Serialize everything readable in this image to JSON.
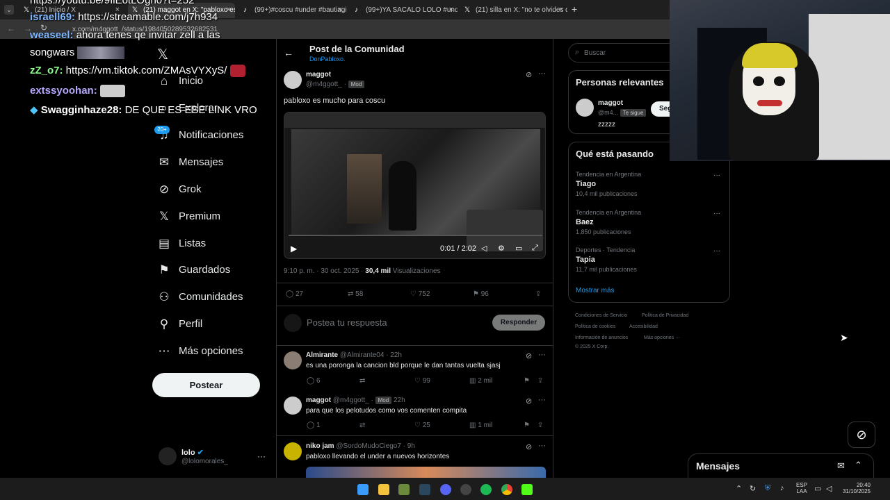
{
  "tabs": [
    {
      "label": "(21) Inicio / X"
    },
    {
      "label": "(21) maggot en X: \"pabloxo es mu"
    },
    {
      "label": "(99+)#coscu #under #bautiagi"
    },
    {
      "label": "(99+)YA SACALO LOLO #under"
    },
    {
      "label": "(21) silla en X: \"no te olvides de"
    }
  ],
  "address": {
    "url": "x.com/m4ggott_/status/1984050289532682531"
  },
  "chat": [
    {
      "user": "",
      "text": "https://youtu.be/9IiEotLOgh0?t=252"
    },
    {
      "user": "israell69:",
      "text": " https://streamable.com/j7h934",
      "color": "#7fb7ff"
    },
    {
      "user": "weaseel:",
      "text": " ahora tenes qe invitar zell a las",
      "color": "#7fb7ff"
    },
    {
      "user": "",
      "text": "songwars"
    },
    {
      "user": "zZ_o7:",
      "text": " https://vm.tiktok.com/ZMAsVYXyS/",
      "color": "#8fff8f"
    },
    {
      "user": "extssyoohan:",
      "text": "",
      "color": "#b8a8ff"
    },
    {
      "user": "Swagginhaze28:",
      "text": " DE QUE ES ESE LINK VRO",
      "color": "#ffffff"
    }
  ],
  "sidebar": {
    "items": [
      {
        "label": "Inicio",
        "icon": "home-icon",
        "glyph": "⌂"
      },
      {
        "label": "Explorar",
        "icon": "search-icon",
        "glyph": "⌕"
      },
      {
        "label": "Notificaciones",
        "icon": "bell-icon",
        "glyph": "♫",
        "badge": "20+"
      },
      {
        "label": "Mensajes",
        "icon": "mail-icon",
        "glyph": "✉"
      },
      {
        "label": "Grok",
        "icon": "grok-icon",
        "glyph": "⊘"
      },
      {
        "label": "Premium",
        "icon": "x-logo-icon",
        "glyph": "𝕏"
      },
      {
        "label": "Listas",
        "icon": "list-icon",
        "glyph": "▤"
      },
      {
        "label": "Guardados",
        "icon": "bookmark-icon",
        "glyph": "⚑"
      },
      {
        "label": "Comunidades",
        "icon": "community-icon",
        "glyph": "⚇"
      },
      {
        "label": "Perfil",
        "icon": "person-icon",
        "glyph": "⚲"
      },
      {
        "label": "Más opciones",
        "icon": "more-icon",
        "glyph": "⋯"
      }
    ],
    "post_button": "Postear",
    "account": {
      "name": "lolo",
      "handle": "@lolomorales_"
    }
  },
  "header": {
    "title": "Post de la Comunidad",
    "community": "DonPabloxo."
  },
  "post": {
    "author": "maggot",
    "handle": "@m4ggott_",
    "badge": "Mod",
    "text": "pabloxo es mucho para coscu",
    "video_time": "0:01 / 2:02",
    "timestamp": "9:10 p. m. · 30 oct. 2025 · ",
    "views_count": "30,4 mil",
    "views_label": " Visualizaciones",
    "replies": "27",
    "reposts": "58",
    "likes": "752",
    "bookmarks": "96"
  },
  "reply_box": {
    "placeholder": "Postea tu respuesta",
    "button": "Responder"
  },
  "replies": [
    {
      "author": "Almirante",
      "handle": "@Almirante04 · 22h",
      "badge": "",
      "text": "es una poronga la cancion bld porque le dan tantas vuelta sjasj",
      "replies": "6",
      "reposts": "",
      "likes": "99",
      "views": "2 mil"
    },
    {
      "author": "maggot",
      "handle": "@m4ggott_ ·",
      "badge": "Mod",
      "time": "22h",
      "text": "para que los pelotudos como vos comenten compita",
      "replies": "1",
      "reposts": "",
      "likes": "25",
      "views": "1 mil"
    },
    {
      "author": "niko jam",
      "handle": "@SordoMudoCiego7 · 9h",
      "badge": "",
      "text": "pabloxo llevando el under a nuevos horizontes"
    }
  ],
  "search": {
    "placeholder": "Buscar"
  },
  "relevant": {
    "title": "Personas relevantes",
    "name": "maggot",
    "handle": "@m4...",
    "follows_you": "Te sigue",
    "follow_button": "Seg",
    "bio": "zzzzz"
  },
  "trending": {
    "title": "Qué está pasando",
    "items": [
      {
        "category": "Tendencia en Argentina",
        "name": "Tiago",
        "count": "10,4 mil publicaciones"
      },
      {
        "category": "Tendencia en Argentina",
        "name": "Baez",
        "count": "1.850 publicaciones"
      },
      {
        "category": "Deportes · Tendencia",
        "name": "Tapia",
        "count": "11,7 mil publicaciones"
      }
    ],
    "show_more": "Mostrar más"
  },
  "footer": {
    "terms": "Condiciones de Servicio",
    "privacy": "Política de Privacidad",
    "cookies": "Política de cookies",
    "accessibility": "Accesibilidad",
    "ads": "Información de anuncios",
    "more": "Más opciones ···",
    "copyright": "© 2025 X Corp."
  },
  "messages": {
    "title": "Mensajes"
  },
  "taskbar": {
    "lang1": "ESP",
    "lang2": "LAA",
    "time": "20:40",
    "date": "31/10/2025"
  },
  "colors": {
    "accent": "#1d9bf0",
    "background": "#000000",
    "border": "#2f3336"
  }
}
